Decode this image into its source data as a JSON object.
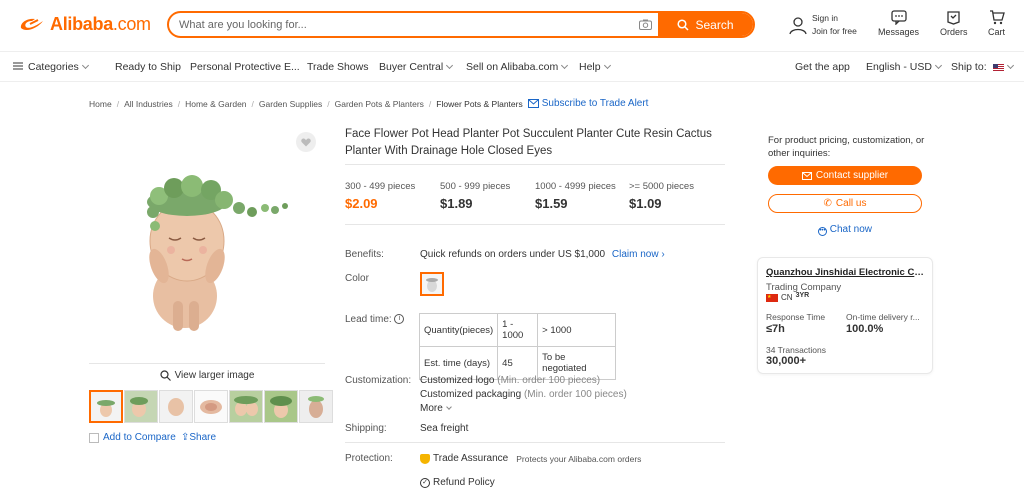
{
  "header": {
    "logo_text": "Alibaba",
    "logo_suffix": ".com",
    "search_placeholder": "What are you looking for...",
    "search_button": "Search",
    "sign_in": "Sign in",
    "join_free": "Join for free",
    "messages": "Messages",
    "orders": "Orders",
    "cart": "Cart"
  },
  "nav": {
    "categories": "Categories",
    "ready_to_ship": "Ready to Ship",
    "ppe": "Personal Protective E...",
    "trade_shows": "Trade Shows",
    "buyer_central": "Buyer Central",
    "sell": "Sell on Alibaba.com",
    "help": "Help",
    "get_app": "Get the app",
    "lang_currency": "English - USD",
    "ship_to": "Ship to:"
  },
  "breadcrumb": [
    "Home",
    "All Industries",
    "Home & Garden",
    "Garden Supplies",
    "Garden Pots & Planters",
    "Flower Pots & Planters"
  ],
  "subscribe": "Subscribe to Trade Alert",
  "gallery": {
    "view_larger": "View larger image",
    "add_compare": "Add to Compare",
    "share": "Share"
  },
  "product": {
    "title": "Face Flower Pot Head Planter Pot Succulent Planter Cute Resin Cactus Planter With Drainage Hole Closed Eyes",
    "tiers": [
      {
        "qty": "300 - 499 pieces",
        "price": "$2.09"
      },
      {
        "qty": "500 - 999 pieces",
        "price": "$1.89"
      },
      {
        "qty": "1000 - 4999 pieces",
        "price": "$1.59"
      },
      {
        "qty": ">= 5000 pieces",
        "price": "$1.09"
      }
    ],
    "benefits_label": "Benefits:",
    "benefits_text": "Quick refunds on orders under US $1,000",
    "claim_now": "Claim now",
    "color_label": "Color",
    "lead_label": "Lead time:",
    "lead_table": {
      "row1": [
        "Quantity(pieces)",
        "1 - 1000",
        "> 1000"
      ],
      "row2": [
        "Est. time (days)",
        "45",
        "To be negotiated"
      ]
    },
    "customization_label": "Customization:",
    "custom_logo": "Customized logo",
    "custom_logo_min": "(Min. order 100 pieces)",
    "custom_pack": "Customized packaging",
    "custom_pack_min": "(Min. order 100 pieces)",
    "more": "More",
    "shipping_label": "Shipping:",
    "shipping_value": "Sea freight",
    "protection_label": "Protection:",
    "trade_assurance": "Trade Assurance",
    "trade_assurance_desc": "Protects your Alibaba.com orders",
    "refund_policy": "Refund Policy"
  },
  "side": {
    "inquiry": "For product pricing, customization, or other inquiries:",
    "contact": "Contact supplier",
    "call": "Call us",
    "chat": "Chat now",
    "supplier_name": "Quanzhou Jinshidai Electronic Com...",
    "supplier_type": "Trading Company",
    "country": "CN",
    "years": "3YR",
    "response_label": "Response Time",
    "response_value": "≤7h",
    "ontime_label": "On-time delivery r...",
    "ontime_value": "100.0%",
    "transactions_label": "34 Transactions",
    "transactions_value": "30,000+"
  },
  "colors": {
    "accent": "#ff6a00",
    "link": "#1a66c7"
  }
}
